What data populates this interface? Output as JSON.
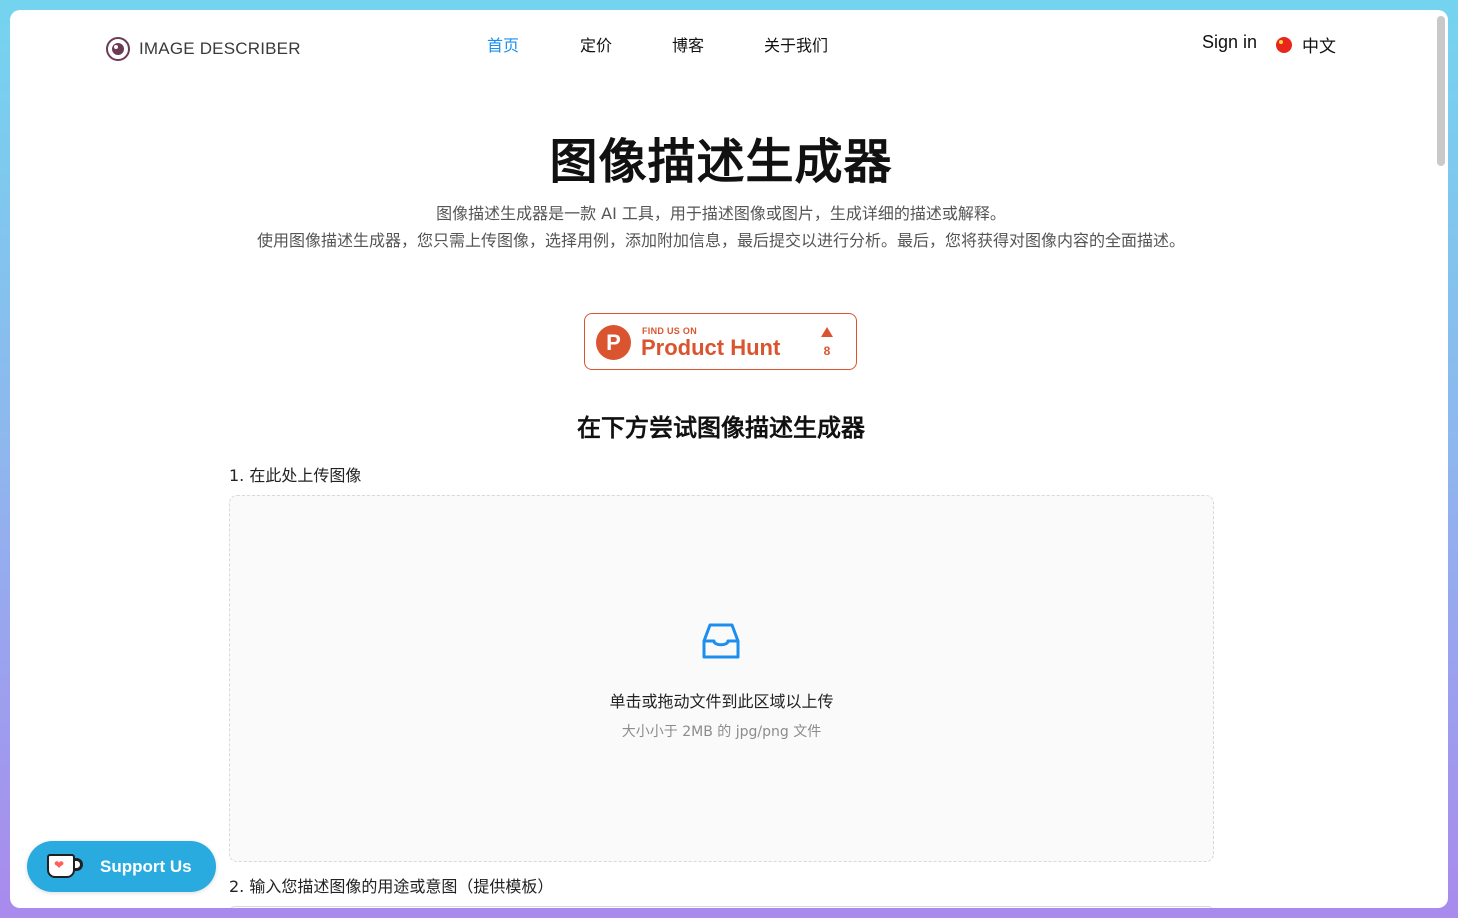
{
  "header": {
    "logo_text": "IMAGE DESCRIBER",
    "nav": [
      {
        "label": "首页",
        "active": true
      },
      {
        "label": "定价",
        "active": false
      },
      {
        "label": "博客",
        "active": false
      },
      {
        "label": "关于我们",
        "active": false
      }
    ],
    "sign_in": "Sign in",
    "language": "中文"
  },
  "hero": {
    "title": "图像描述生成器",
    "description_line1": "图像描述生成器是一款 AI 工具，用于描述图像或图片，生成详细的描述或解释。",
    "description_line2": "使用图像描述生成器，您只需上传图像，选择用例，添加附加信息，最后提交以进行分析。最后，您将获得对图像内容的全面描述。"
  },
  "product_hunt": {
    "small_text": "FIND US ON",
    "big_text": "Product Hunt",
    "logo_letter": "P",
    "upvotes": "8"
  },
  "try_section": {
    "title": "在下方尝试图像描述生成器",
    "step1_label": "1. 在此处上传图像",
    "upload_text": "单击或拖动文件到此区域以上传",
    "upload_hint": "大小小于 2MB 的 jpg/png 文件",
    "step2_label": "2. 输入您描述图像的用途或意图（提供模板）"
  },
  "support": {
    "label": "Support Us"
  },
  "colors": {
    "accent": "#1c8ef0",
    "product_hunt": "#da552f",
    "support_bg": "#29abe0"
  }
}
